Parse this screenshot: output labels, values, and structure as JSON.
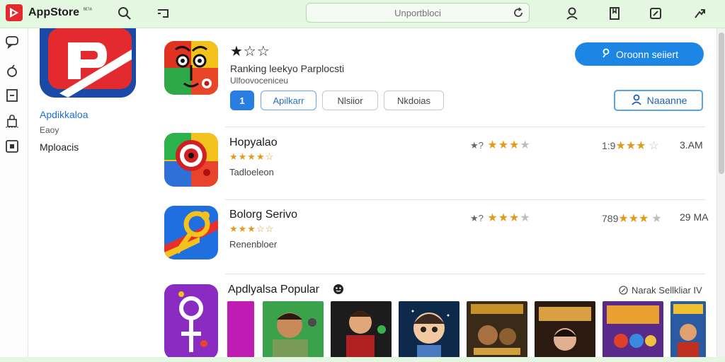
{
  "topbar": {
    "brand": "AppStore",
    "brand_sup": "ᴮᴱᵀᴬ",
    "search_placeholder": "Unportbloci",
    "icons": [
      "search-icon",
      "cast-icon",
      "refresh-icon",
      "account-icon",
      "bookmark-icon",
      "edit-icon",
      "share-icon"
    ]
  },
  "rail": {
    "icons": [
      "chat-icon",
      "rocket-icon",
      "window-icon",
      "lock-icon",
      "media-icon"
    ]
  },
  "featured": {
    "title": "Apdikkaloa",
    "subtitle": "Eaoy",
    "link": "Mploacis"
  },
  "hero": {
    "stars": "★☆☆",
    "title": "Ranking leekyo Parplocsti",
    "subtitle": "Ulfoovoceniceu",
    "chips": [
      "1",
      "Apilkarr",
      "Nlsiior",
      "Nkdoias"
    ],
    "primary_button": "Oroonn seiiert",
    "outline_button": "Naaanne"
  },
  "apps": [
    {
      "name": "Hopyalao",
      "stars": "★★★★☆",
      "category": "Tadloeleon",
      "rating_prefix": "★?",
      "rating_stars": "★★★",
      "rating_off": "★",
      "count_prefix": "1:9",
      "count_stars": "★★★",
      "count_off": "☆",
      "size": "3.AM"
    },
    {
      "name": "Bolorg Serivo",
      "stars": "★★★☆☆",
      "category": "Renenbloer",
      "rating_prefix": "★?",
      "rating_stars": "★★★",
      "rating_off": "★",
      "count_prefix": "789",
      "count_stars": "★★★",
      "count_off": "★",
      "size": "29 MA"
    }
  ],
  "popular": {
    "title": "Apdlyalsa Popular",
    "link": "Narak Sellkliar IV"
  },
  "colors": {
    "topbar": "#e4f7e1",
    "accent_blue": "#1d86e5",
    "star": "#e39a1c",
    "brand_red": "#e22a2f"
  }
}
